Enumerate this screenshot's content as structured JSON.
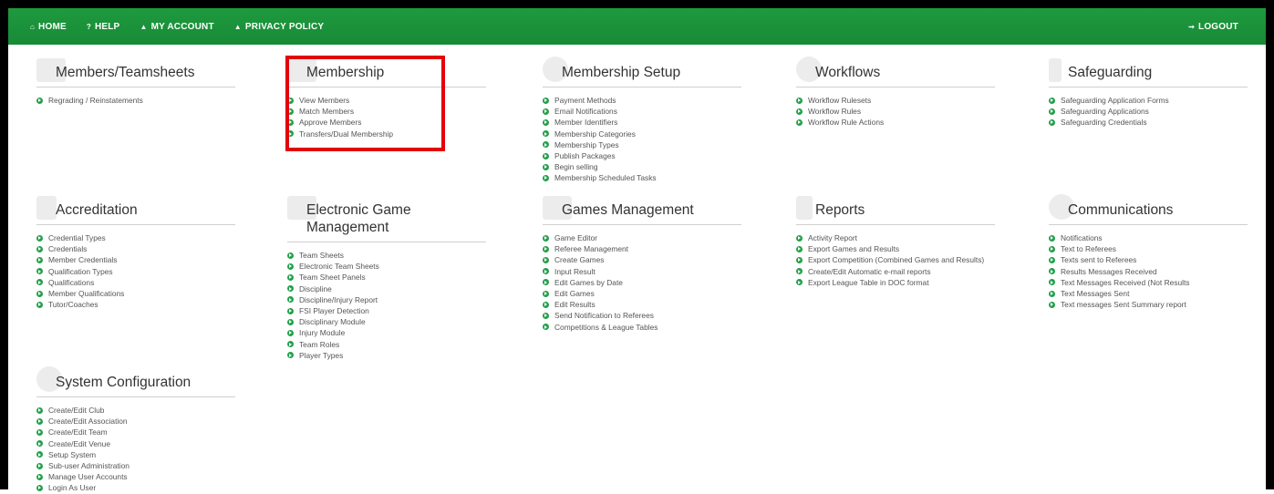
{
  "nav": {
    "home": "HOME",
    "help": "HELP",
    "my_account": "MY ACCOUNT",
    "privacy_policy": "PRIVACY POLICY",
    "logout": "LOGOUT"
  },
  "colors": {
    "brand_green": "#1e9a3f",
    "highlight_red": "#e3000f"
  },
  "sections": {
    "members_teamsheets": {
      "title": "Members/Teamsheets",
      "items": [
        "Regrading / Reinstatements"
      ]
    },
    "membership": {
      "title": "Membership",
      "items": [
        "View Members",
        "Match Members",
        "Approve Members",
        "Transfers/Dual Membership"
      ]
    },
    "membership_setup": {
      "title": "Membership Setup",
      "items": [
        "Payment Methods",
        "Email Notifications",
        "Member Identifiers",
        "Membership Categories",
        "Membership Types",
        "Publish Packages",
        "Begin selling",
        "Membership Scheduled Tasks"
      ]
    },
    "workflows": {
      "title": "Workflows",
      "items": [
        "Workflow Rulesets",
        "Workflow Rules",
        "Workflow Rule Actions"
      ]
    },
    "safeguarding": {
      "title": "Safeguarding",
      "items": [
        "Safeguarding Application Forms",
        "Safeguarding Applications",
        "Safeguarding Credentials"
      ]
    },
    "accreditation": {
      "title": "Accreditation",
      "items": [
        "Credential Types",
        "Credentials",
        "Member Credentials",
        "Qualification Types",
        "Qualifications",
        "Member Qualifications",
        "Tutor/Coaches"
      ]
    },
    "electronic_game_management": {
      "title": "Electronic Game Management",
      "items": [
        "Team Sheets",
        "Electronic Team Sheets",
        "Team Sheet Panels",
        "Discipline",
        "Discipline/Injury Report",
        "FSI Player Detection",
        "Disciplinary Module",
        "Injury Module",
        "Team Roles",
        "Player Types"
      ]
    },
    "games_management": {
      "title": "Games Management",
      "items": [
        "Game Editor",
        "Referee Management",
        "Create Games",
        "Input Result",
        "Edit Games by Date",
        "Edit Games",
        "Edit Results",
        "Send Notification to Referees",
        "Competitions & League Tables"
      ]
    },
    "reports": {
      "title": "Reports",
      "items": [
        "Activity Report",
        "Export Games and Results",
        "Export Competition (Combined Games and Results)",
        "Create/Edit Automatic e-mail reports",
        "Export League Table in DOC format"
      ]
    },
    "communications": {
      "title": "Communications",
      "items": [
        "Notifications",
        "Text to Referees",
        "Texts sent to Referees",
        "Results Messages Received",
        "Text Messages Received (Not Results",
        "Text Messages Sent",
        "Text messages Sent Summary report"
      ]
    },
    "system_configuration": {
      "title": "System Configuration",
      "items": [
        "Create/Edit Club",
        "Create/Edit Association",
        "Create/Edit Team",
        "Create/Edit Venue",
        "Setup System",
        "Sub-user Administration",
        "Manage User Accounts",
        "Login As User"
      ]
    }
  }
}
